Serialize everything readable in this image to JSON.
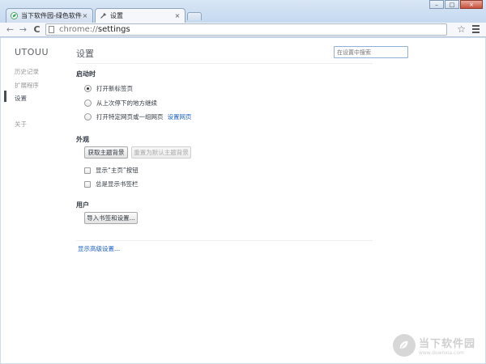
{
  "tabs": [
    {
      "title": "当下软件园-绿色软件_最新",
      "close": "×",
      "icon": "leaf-icon"
    },
    {
      "title": "设置",
      "close": "×",
      "icon": "wrench-icon"
    }
  ],
  "window_controls": {
    "minimize": "–",
    "maximize": "□",
    "close": "×"
  },
  "toolbar": {
    "back": "←",
    "forward": "→",
    "reload": "C",
    "url_scheme": "chrome://",
    "url_path": "settings",
    "star": "☆"
  },
  "sidebar": {
    "brand": "UTOUU",
    "items": [
      {
        "label": "历史记录"
      },
      {
        "label": "扩展程序"
      },
      {
        "label": "设置"
      },
      {
        "label": "关于"
      }
    ]
  },
  "main": {
    "title": "设置",
    "search_placeholder": "在设置中搜索",
    "startup": {
      "title": "启动时",
      "options": [
        {
          "label": "打开新标签页",
          "checked": true
        },
        {
          "label": "从上次停下的地方继续",
          "checked": false
        },
        {
          "label": "打开特定网页或一组网页",
          "checked": false
        }
      ],
      "set_pages_link": "设置网页"
    },
    "appearance": {
      "title": "外观",
      "get_themes_button": "获取主题背景",
      "reset_theme_button": "重置为默认主题背景",
      "show_home_button": "显示“主页”按钮",
      "show_bookmarks_bar": "总是显示书签栏"
    },
    "users": {
      "title": "用户",
      "import_button": "导入书签和设置..."
    },
    "advanced_link": "显示高级设置..."
  },
  "watermark": {
    "name": "当下软件园",
    "url": "www.downxia.com"
  }
}
